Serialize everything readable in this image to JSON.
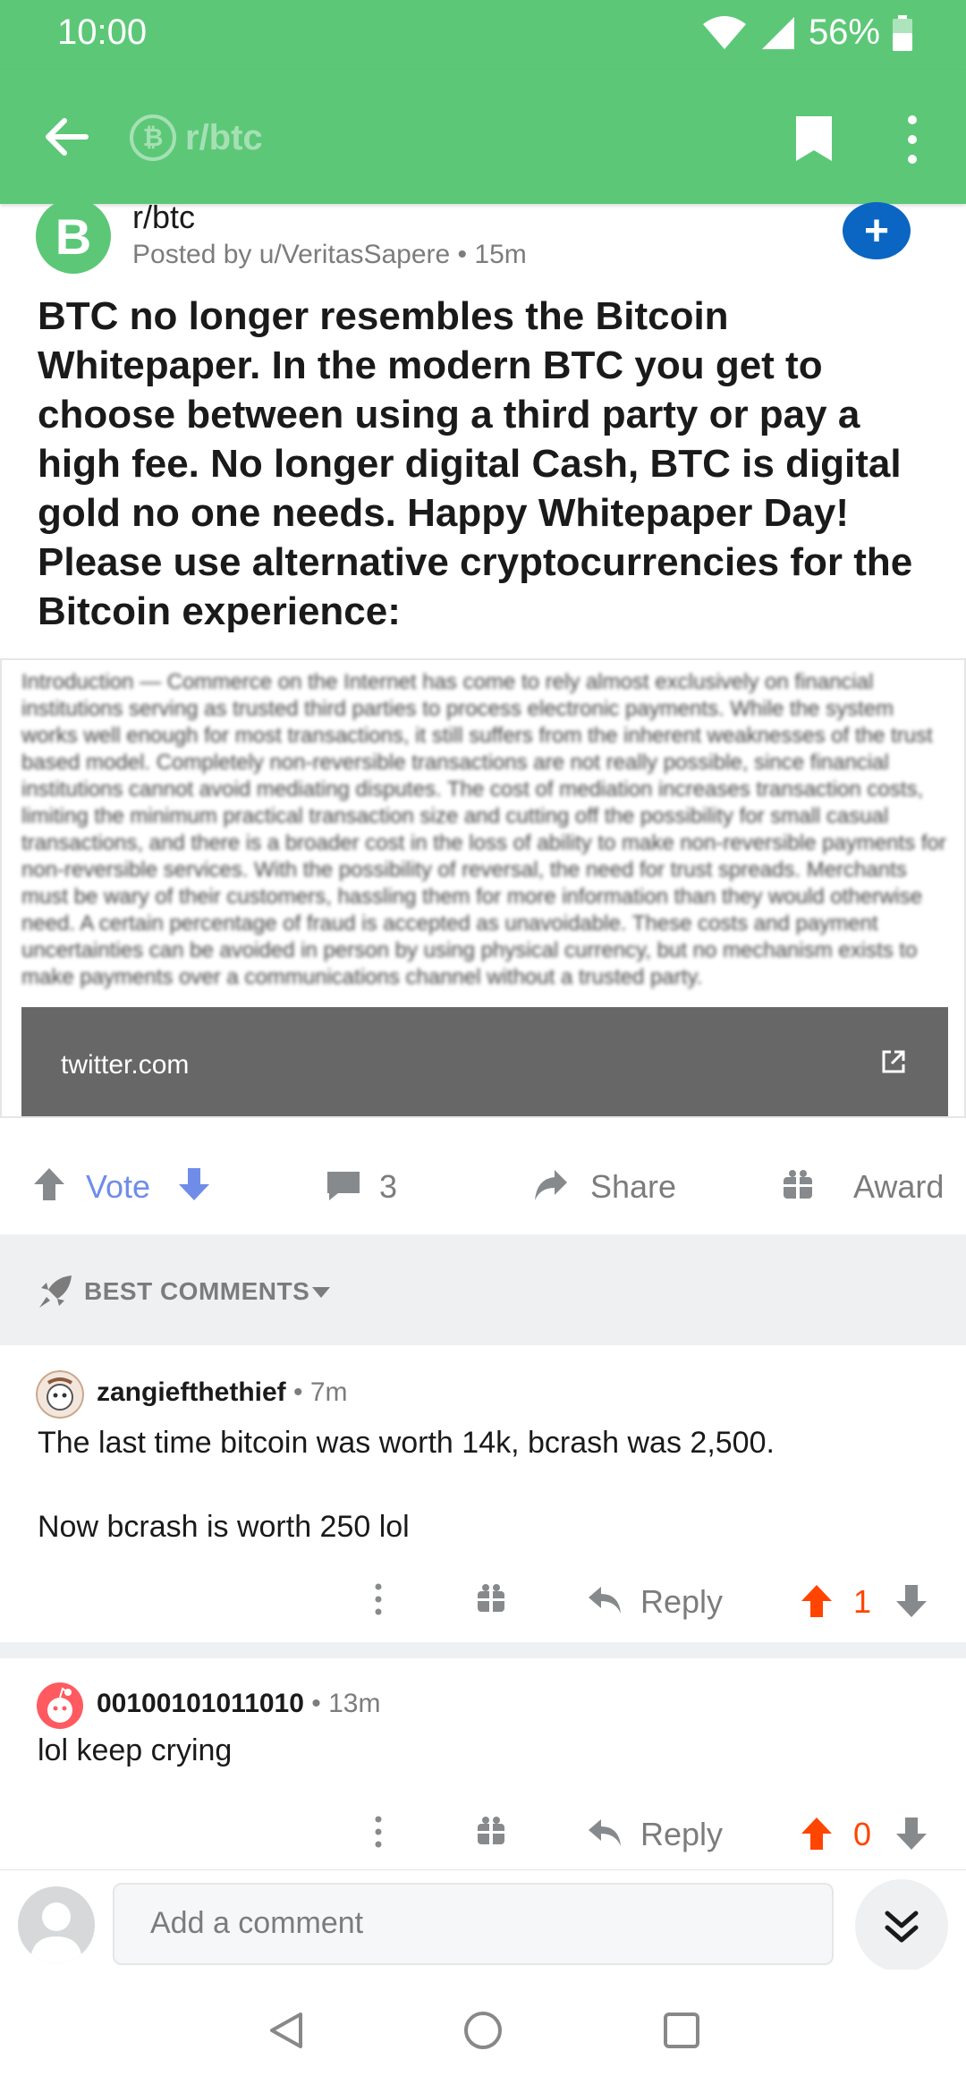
{
  "status": {
    "time": "10:00",
    "battery": "56%"
  },
  "appbar": {
    "subreddit": "r/btc",
    "coin_glyph": "₿"
  },
  "post": {
    "subreddit": "r/btc",
    "avatar_glyph": "B",
    "posted_by": "Posted by u/VeritasSapere • 15m",
    "title": "BTC no longer resembles the Bitcoin Whitepaper. In the modern BTC you get to choose between using a third party or pay a high fee. No longer digital Cash, BTC is digital gold no one needs. Happy Whitepaper Day! Please use alternative cryptocurrencies for the Bitcoin experience:",
    "join_glyph": "+",
    "embed": {
      "domain": "twitter.com",
      "blurred_text": "Introduction — Commerce on the Internet has come to rely almost exclusively on financial institutions serving as trusted third parties to process electronic payments. While the system works well enough for most transactions, it still suffers from the inherent weaknesses of the trust based model. Completely non-reversible transactions are not really possible, since financial institutions cannot avoid mediating disputes. The cost of mediation increases transaction costs, limiting the minimum practical transaction size and cutting off the possibility for small casual transactions, and there is a broader cost in the loss of ability to make non-reversible payments for non-reversible services. With the possibility of reversal, the need for trust spreads. Merchants must be wary of their customers, hassling them for more information than they would otherwise need. A certain percentage of fraud is accepted as unavoidable. These costs and payment uncertainties can be avoided in person by using physical currency, but no mechanism exists to make payments over a communications channel without a trusted party."
    }
  },
  "actions": {
    "vote": "Vote",
    "comments": "3",
    "share": "Share",
    "award": "Award"
  },
  "sort": {
    "label": "BEST COMMENTS"
  },
  "comments": [
    {
      "username": "zangiefthethief",
      "age": "• 7m",
      "body_line1": "The last time bitcoin was worth 14k, bcrash was 2,500.",
      "body_line2": "Now bcrash is worth 250 lol",
      "reply": "Reply",
      "score": "1"
    },
    {
      "username": "00100101011010",
      "age": "• 13m",
      "body_line1": "lol keep crying",
      "reply": "Reply",
      "score": "0"
    }
  ],
  "composer": {
    "placeholder": "Add a comment"
  },
  "colors": {
    "brand": "#5cc877",
    "upvote": "#ff4500",
    "vote_label": "#6f8de8",
    "join": "#0a66c2"
  }
}
